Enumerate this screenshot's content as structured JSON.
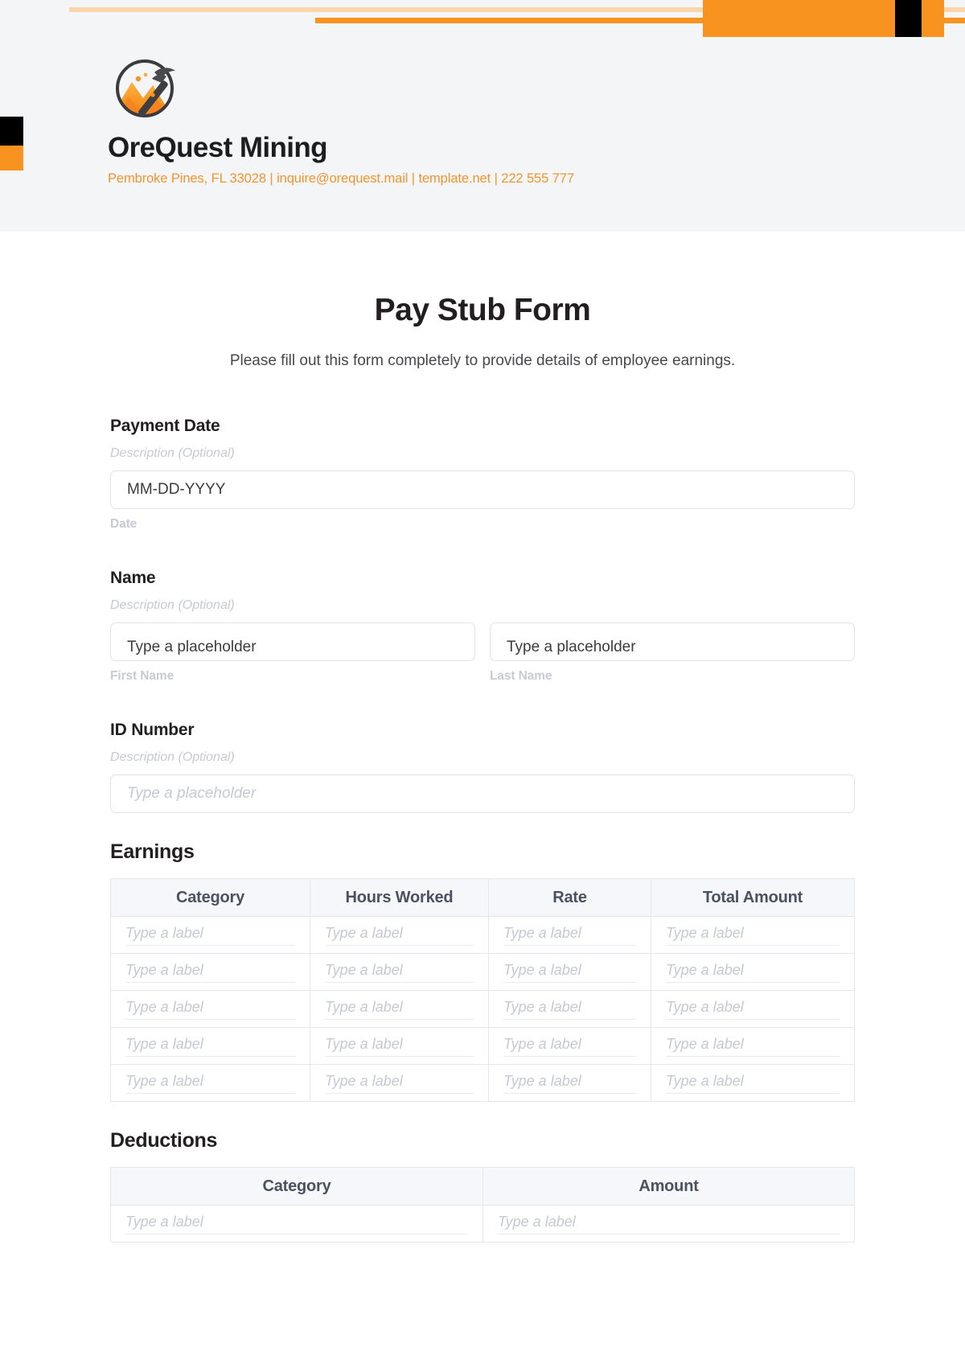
{
  "brand": {
    "name": "OreQuest Mining",
    "contact": "Pembroke Pines, FL 33028 | inquire@orequest.mail | template.net | 222 555 777",
    "accent_color": "#f7931e",
    "logo_icon": "mining-pickaxe-circle-logo"
  },
  "form": {
    "title": "Pay Stub Form",
    "subtitle": "Please fill out this form completely to provide details of employee earnings."
  },
  "fields": {
    "payment_date": {
      "label": "Payment Date",
      "description": "Description (Optional)",
      "value": "MM-DD-YYYY",
      "sub_label": "Date"
    },
    "name": {
      "label": "Name",
      "description": "Description (Optional)",
      "first": {
        "value": "Type a placeholder",
        "sub_label": "First Name"
      },
      "last": {
        "value": "Type a placeholder",
        "sub_label": "Last Name"
      }
    },
    "id_number": {
      "label": "ID Number",
      "description": "Description (Optional)",
      "placeholder": "Type a placeholder"
    }
  },
  "earnings": {
    "title": "Earnings",
    "columns": [
      "Category",
      "Hours Worked",
      "Rate",
      "Total Amount"
    ],
    "cell_placeholder": "Type a label",
    "row_count": 5
  },
  "deductions": {
    "title": "Deductions",
    "columns": [
      "Category",
      "Amount"
    ],
    "cell_placeholder": "Type a label",
    "row_count": 1
  }
}
